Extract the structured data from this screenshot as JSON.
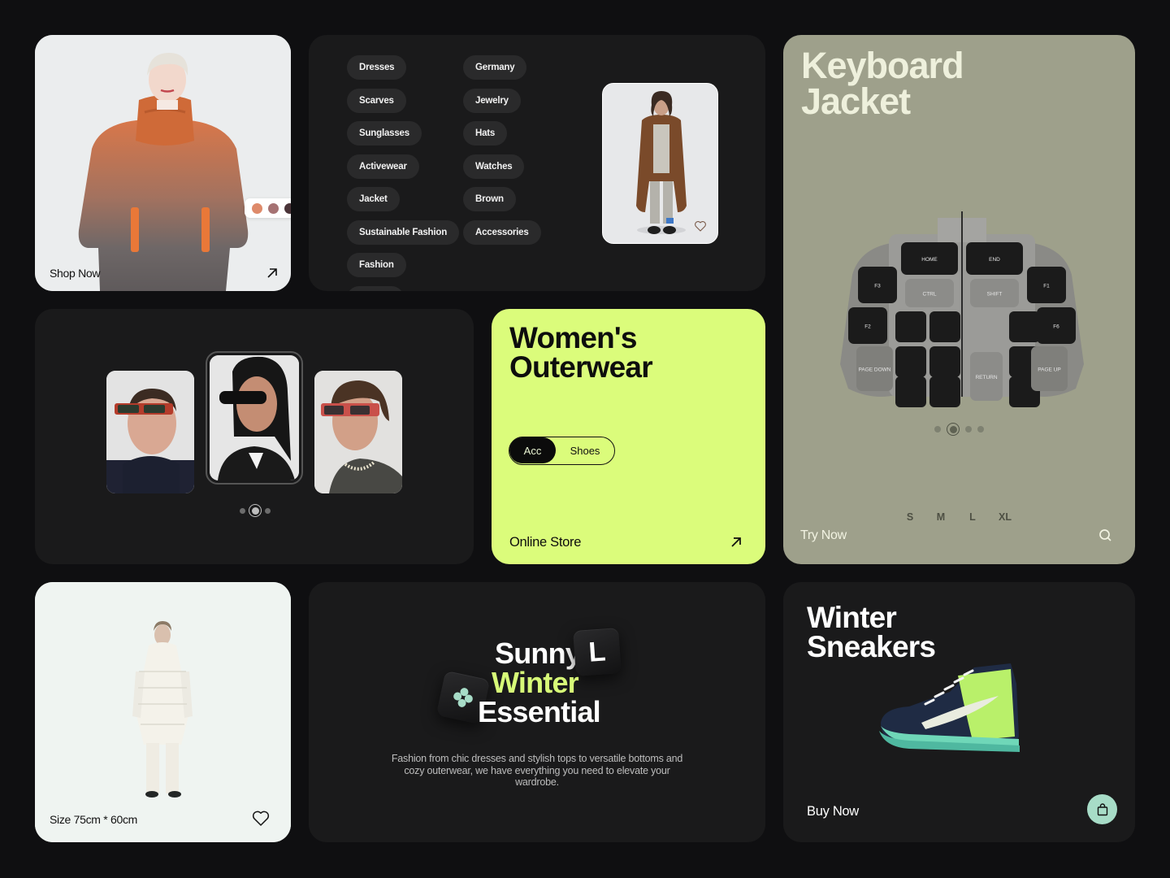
{
  "cards": {
    "shop_now": {
      "label": "Shop Now",
      "swatches": [
        "#de8a6a",
        "#a57273",
        "#4a3439"
      ],
      "arrow_icon": "arrow-up-right-icon"
    },
    "categories": {
      "chips_col1": [
        "Dresses",
        "Scarves",
        "Sunglasses",
        "Activewear",
        "Jacket",
        "Sustainable Fashion",
        "Fashion"
      ],
      "chips_col2": [
        "Germany",
        "Jewelry",
        "Hats",
        "Watches",
        "Brown",
        "Accessories"
      ],
      "favorite_icon": "heart-icon"
    },
    "keyboard_jacket": {
      "title_line1": "Keyboard",
      "title_line2": "Jacket",
      "carousel": {
        "count": 4,
        "active_index": 1
      },
      "sizes": [
        "S",
        "M",
        "L",
        "XL"
      ],
      "cta": "Try Now",
      "search_icon": "search-icon",
      "keys": [
        "HOME",
        "END",
        "CTRL",
        "SHIFT",
        "F3",
        "F2",
        "F1",
        "F6",
        "RETURN",
        "PAGE DOWN",
        "PAGE UP"
      ]
    },
    "sunglasses": {
      "carousel": {
        "count": 3,
        "active_index": 1
      }
    },
    "womens_outerwear": {
      "title_line1": "Women's",
      "title_line2": "Outerwear",
      "toggle": {
        "options": [
          "Acc",
          "Shoes"
        ],
        "selected": "Acc"
      },
      "cta": "Online Store",
      "arrow_icon": "arrow-up-right-icon"
    },
    "white_coat": {
      "size_label": "Size 75cm * 60cm",
      "favorite_icon": "heart-icon"
    },
    "sunny_winter": {
      "line1": "Sunny",
      "line2": "Winter",
      "line3": "Essential",
      "keycap_letter": "L",
      "description": "Fashion from chic dresses and stylish tops to versatile bottoms and cozy outerwear, we have everything you need to elevate your wardrobe."
    },
    "winter_sneakers": {
      "title_line1": "Winter",
      "title_line2": "Sneakers",
      "cta": "Buy Now",
      "bag_icon": "shopping-bag-icon"
    }
  },
  "colors": {
    "page_bg": "#0f0f11",
    "card_dark": "#1a1a1b",
    "lime_accent": "#dbfc7b",
    "sage": "#9ea08b",
    "mint": "#a7dcc7"
  }
}
